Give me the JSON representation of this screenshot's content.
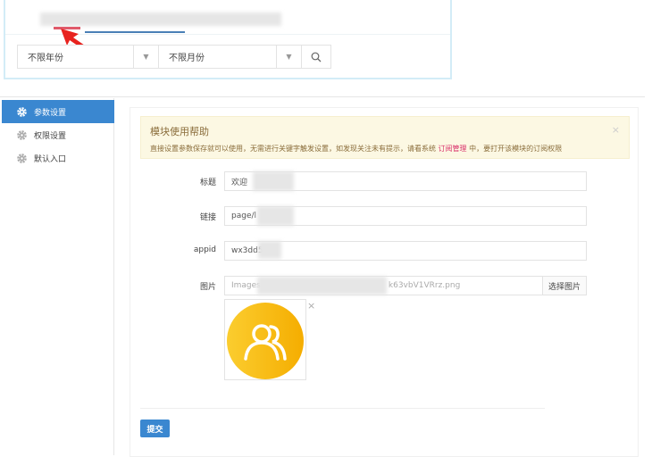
{
  "filters": {
    "year": "不限年份",
    "month": "不限月份"
  },
  "sidebar": {
    "items": [
      {
        "label": "参数设置",
        "active": true
      },
      {
        "label": "权限设置"
      },
      {
        "label": "默认入口"
      }
    ]
  },
  "alert": {
    "title": "模块使用帮助",
    "text_before": "直接设置参数保存就可以使用，无需进行关键字触发设置，如发现关注未有提示，请看系统 ",
    "link": "订阅管理",
    "text_after": " 中，要打开该模块的订阅权限",
    "close": "×"
  },
  "form": {
    "title_label": "标题",
    "title_value": "欢迎",
    "link_label": "链接",
    "link_value": "page/l",
    "appid_label": "appid",
    "appid_value": "wx3dd5",
    "image_label": "图片",
    "image_value_start": "Images",
    "image_value_end": "k63vbV1VRrz.png",
    "image_button": "选择图片",
    "image_remove": "×",
    "submit": "提交"
  },
  "colors": {
    "primary": "#3a87d0",
    "alert_bg": "#fcf8e3",
    "link": "#d9306a",
    "avatar": "#f7b500"
  }
}
